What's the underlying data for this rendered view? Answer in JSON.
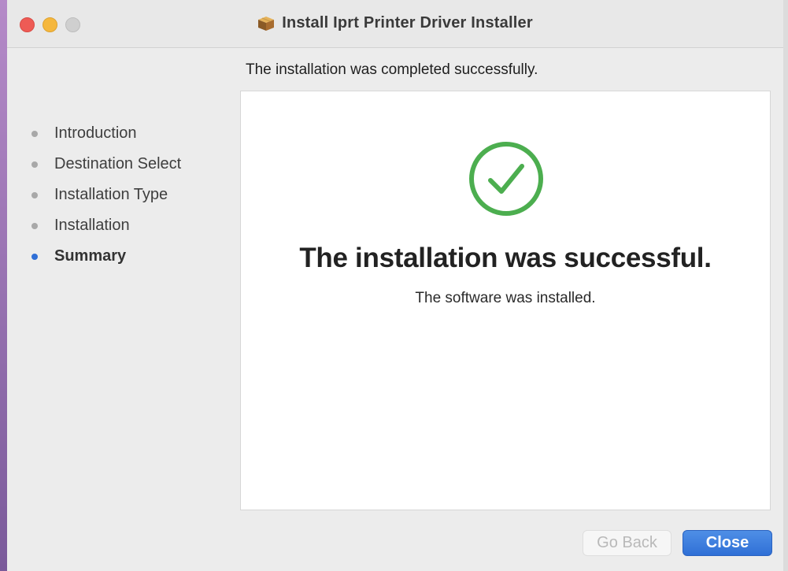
{
  "window": {
    "title": "Install Iprt Printer Driver Installer"
  },
  "header": {
    "subheading": "The installation was completed successfully."
  },
  "sidebar": {
    "steps": [
      {
        "label": "Introduction",
        "active": false
      },
      {
        "label": "Destination Select",
        "active": false
      },
      {
        "label": "Installation Type",
        "active": false
      },
      {
        "label": "Installation",
        "active": false
      },
      {
        "label": "Summary",
        "active": true
      }
    ]
  },
  "main": {
    "icon": "checkmark-circle-icon",
    "title": "The installation was successful.",
    "message": "The software was installed."
  },
  "buttons": {
    "back_label": "Go Back",
    "close_label": "Close"
  },
  "colors": {
    "success_green": "#4cae4f",
    "accent_blue": "#2f6fd6",
    "step_inactive": "#a8a8a8"
  }
}
